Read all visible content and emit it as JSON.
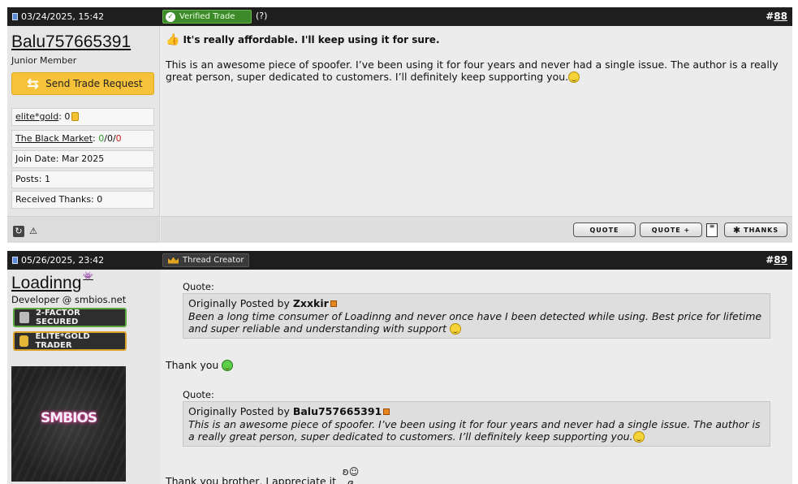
{
  "post1": {
    "date": "03/24/2025, 15:42",
    "verified_badge": "Verified Trade",
    "help_link": "(?)",
    "post_number_prefix": "#",
    "post_number": "88",
    "username": "Balu757665391",
    "usertitle": "Junior Member",
    "trade_button": "Send Trade Request",
    "elitegold_label": "elite*gold",
    "elitegold_value": ": 0",
    "market_label": "The Black Market",
    "market_sep": ": ",
    "market_pos": "0",
    "market_neu": "0",
    "market_neg": "0",
    "join_date": "Join Date: Mar 2025",
    "posts": "Posts: 1",
    "received_thanks": "Received Thanks: 0",
    "title": "It's really affordable. I'll keep using it for sure.",
    "body": "This is an awesome piece of spoofer. I’ve been using it for four years and never had a single issue. The author is a really great person, super dedicated to customers. I’ll definitely keep supporting you.",
    "buttons": {
      "quote": "QUOTE",
      "quote_plus": "QUOTE +",
      "thanks": "THANKS"
    }
  },
  "post2": {
    "date": "05/26/2025, 23:42",
    "creator_badge": "Thread Creator",
    "post_number_prefix": "#",
    "post_number": "89",
    "username": "Loadinng",
    "usertitle": "Developer @ smbios.net",
    "badge_2fa": "2-FACTOR SECURED",
    "badge_gold": "ELITE*GOLD TRADER",
    "avatar_text": "SMBIOS",
    "quote_label": "Quote:",
    "quote1_prefix": "Originally Posted by ",
    "quote1_author": "Zxxkir",
    "quote1_text": "Been a long time consumer of Loadinng and never once have I been detected while using. Best price for lifetime and super reliable and understanding with support",
    "reply1": "Thank you",
    "quote2_prefix": "Originally Posted by ",
    "quote2_author": "Balu757665391",
    "quote2_text": "This is an awesome piece of spoofer. I’ve been using it for four years and never had a single issue. The author is a really great person, super dedicated to customers. I’ll definitely keep supporting you.",
    "reply2": "Thank you brother, I appreciate it"
  },
  "icons": [
    "doc-icon",
    "check-icon",
    "arrows-icon",
    "coin-icon",
    "reload-icon",
    "warning-icon",
    "thumbs-up-icon",
    "smiley-icon",
    "multiquote-icon",
    "star-icon",
    "crown-icon",
    "space-invader-icon",
    "lock-icon",
    "coins-icon",
    "view-post-icon",
    "grin-icon",
    "candy-icon"
  ],
  "colors": {
    "header": "#1e1e1e",
    "verified": "#3d8a2b",
    "trade_button": "#f6c23a",
    "positive": "#2a9d2a",
    "negative": "#d01f1f"
  }
}
